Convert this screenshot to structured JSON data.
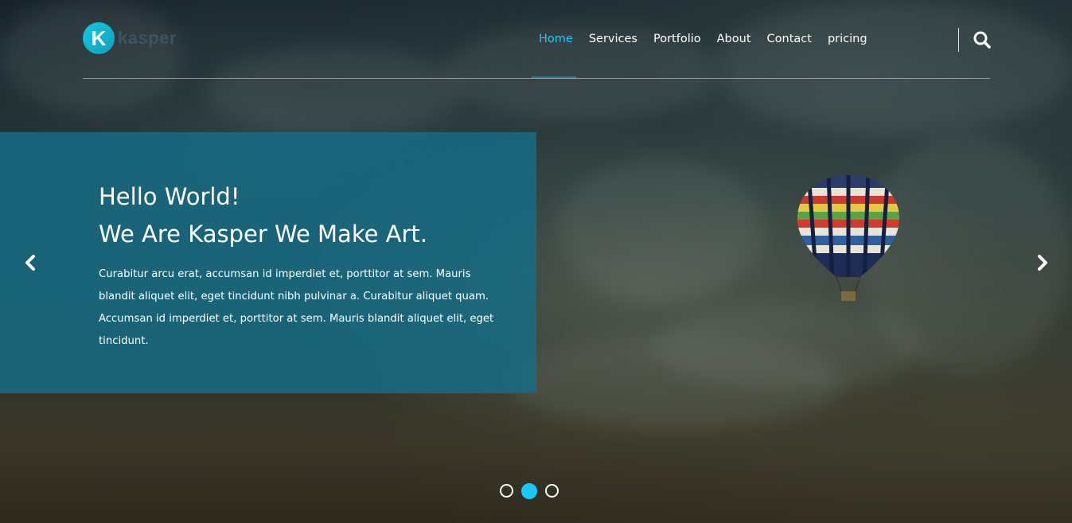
{
  "brand": {
    "logo_letter": "K",
    "name": "kasper",
    "accent_color": "#19c8fa"
  },
  "nav": {
    "items": [
      {
        "label": "Home",
        "active": true
      },
      {
        "label": "Services",
        "active": false
      },
      {
        "label": "Portfolio",
        "active": false
      },
      {
        "label": "About",
        "active": false
      },
      {
        "label": "Contact",
        "active": false
      },
      {
        "label": "pricing",
        "active": false
      }
    ],
    "search_icon": "search-icon"
  },
  "hero": {
    "headline_line1": "Hello World!",
    "headline_line2": "We Are Kasper We Make Art.",
    "description": "Curabitur arcu erat, accumsan id imperdiet et, porttitor at sem. Mauris blandit aliquet elit, eget tincidunt nibh pulvinar a. Curabitur aliquet quam. Accumsan id imperdiet et, porttitor at sem. Mauris blandit aliquet elit, eget tincidunt.",
    "panel_color": "#166e87"
  },
  "slider": {
    "prev_icon": "chevron-left-icon",
    "next_icon": "chevron-right-icon",
    "bullets_count": 3,
    "active_bullet": 2
  }
}
